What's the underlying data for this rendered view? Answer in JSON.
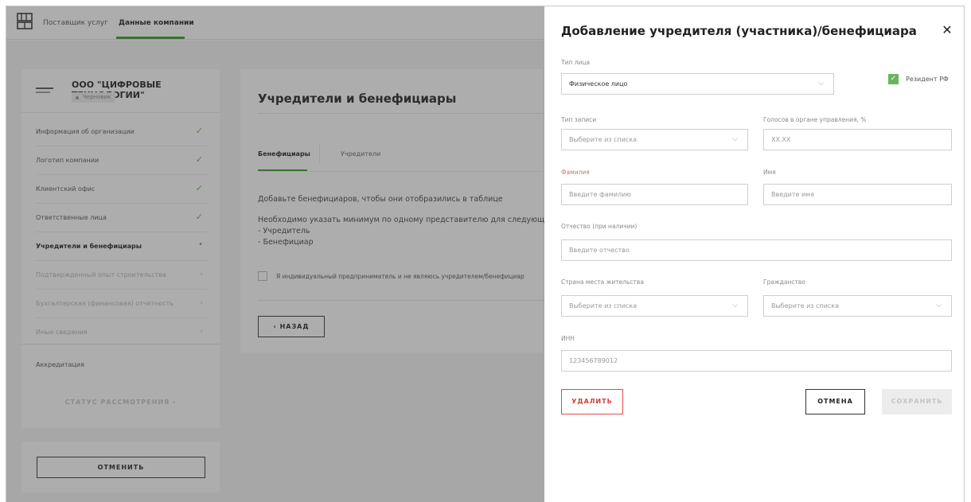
{
  "topbar": {
    "links": [
      "Поставщик услуг",
      "Данные компании"
    ]
  },
  "company": {
    "name": "ООО \"ЦИФРОВЫЕ ТЕХНОЛОГИИ\"",
    "status": "Черновик"
  },
  "sidebar": {
    "items": [
      {
        "label": "Информация об организации",
        "state": "done"
      },
      {
        "label": "Логотип компании",
        "state": "done"
      },
      {
        "label": "Клиентский офис",
        "state": "done"
      },
      {
        "label": "Ответственные лица",
        "state": "done"
      },
      {
        "label": "Учредители и бенефициары",
        "state": "active"
      },
      {
        "label": "Подтвержденный опыт строительства",
        "state": "disabled"
      },
      {
        "label": "Бухгалтерская (финансовая) отчетность",
        "state": "disabled"
      },
      {
        "label": "Иные сведения",
        "state": "disabled"
      }
    ],
    "accreditation": "Аккредитация",
    "status_link": "СТАТУС РАССМОТРЕНИЯ  ›",
    "cancel": "ОТМЕНИТЬ"
  },
  "main": {
    "title": "Учредители и бенефициары",
    "tabs": [
      "Бенефициары",
      "Учредители"
    ],
    "hint": "Добавьте бенефициаров, чтобы они отобразились в таблице",
    "requirement": "Необходимо указать минимум по одному представителю для следующих р",
    "roles": [
      "- Учредитель",
      "- Бенефициар"
    ],
    "ip_checkbox": "Я индивидуальный предприниматель и не являюсь учредителем/бенефициар",
    "back": "‹  НАЗАД"
  },
  "modal": {
    "title": "Добавление учредителя (участника)/бенефициара",
    "close": "✕",
    "person_type": {
      "label": "Тип лица",
      "value": "Физическое лицо"
    },
    "resident": {
      "label": "Резидент РФ",
      "checked": true
    },
    "record_type": {
      "label": "Тип записи",
      "placeholder": "Выберите из списка"
    },
    "votes": {
      "label": "Голосов в органе управления, %",
      "placeholder": "XX.XX"
    },
    "surname": {
      "label": "Фамилия",
      "placeholder": "Введите фамилию"
    },
    "name": {
      "label": "Имя",
      "placeholder": "Введите имя"
    },
    "patronymic": {
      "label": "Отчество (при наличии)",
      "placeholder": "Введите отчество"
    },
    "country": {
      "label": "Страна места жительства",
      "placeholder": "Выберите из списка"
    },
    "citizenship": {
      "label": "Гражданство",
      "placeholder": "Выберите из списка"
    },
    "inn": {
      "label": "ИНН",
      "value": "123456789012"
    },
    "buttons": {
      "delete": "УДАЛИТЬ",
      "cancel": "ОТМЕНА",
      "save": "СОХРАНИТЬ"
    }
  },
  "colors": {
    "accent": "#3a9a2e",
    "danger": "#e04b4b",
    "check": "#67b65a"
  }
}
